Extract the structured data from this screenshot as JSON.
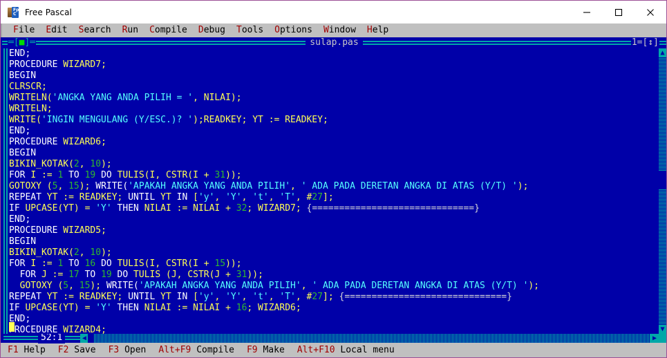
{
  "window": {
    "title": "Free Pascal",
    "icon": "free-pascal-logo-icon",
    "controls": {
      "minimize": "minimize-icon",
      "maximize": "maximize-icon",
      "close": "close-icon"
    }
  },
  "menubar": {
    "items": [
      {
        "hotkey": "F",
        "rest": "ile"
      },
      {
        "hotkey": "E",
        "rest": "dit"
      },
      {
        "hotkey": "S",
        "rest": "earch"
      },
      {
        "hotkey": "R",
        "rest": "un"
      },
      {
        "hotkey": "C",
        "rest": "ompile"
      },
      {
        "hotkey": "D",
        "rest": "ebug"
      },
      {
        "hotkey": "T",
        "rest": "ools"
      },
      {
        "hotkey": "O",
        "rest": "ptions"
      },
      {
        "hotkey": "W",
        "rest": "indow"
      },
      {
        "hotkey": "H",
        "rest": "elp"
      }
    ]
  },
  "editor": {
    "close_box": "[■]",
    "file_name": "sulap.pas",
    "window_number": "1=[↕]",
    "position": "52:1",
    "colors": {
      "background": "#0000a8",
      "keyword": "#ffffff",
      "identifier": "#ffff55",
      "string": "#55ffff",
      "number": "#2fb82f",
      "comment": "#d8d8d8",
      "frame": "#00a8a8"
    },
    "lines": [
      [
        {
          "t": "END;",
          "c": "kw"
        }
      ],
      [
        {
          "t": "PROCEDURE ",
          "c": "kw"
        },
        {
          "t": "WIZARD7;",
          "c": "id"
        }
      ],
      [
        {
          "t": "BEGIN",
          "c": "kw"
        }
      ],
      [
        {
          "t": "CLRSCR;",
          "c": "id"
        }
      ],
      [
        {
          "t": "WRITELN(",
          "c": "id"
        },
        {
          "t": "'ANGKA YANG ANDA PILIH = '",
          "c": "str"
        },
        {
          "t": ", NILAI);",
          "c": "id"
        }
      ],
      [
        {
          "t": "WRITELN;",
          "c": "id"
        }
      ],
      [
        {
          "t": "WRITE(",
          "c": "id"
        },
        {
          "t": "'INGIN MENGULANG (Y/ESC.)? '",
          "c": "str"
        },
        {
          "t": ");READKEY; YT := READKEY;",
          "c": "id"
        }
      ],
      [
        {
          "t": "END;",
          "c": "kw"
        }
      ],
      [
        {
          "t": "PROCEDURE ",
          "c": "kw"
        },
        {
          "t": "WIZARD6;",
          "c": "id"
        }
      ],
      [
        {
          "t": "BEGIN",
          "c": "kw"
        }
      ],
      [
        {
          "t": "BIKIN_KOTAK(",
          "c": "id"
        },
        {
          "t": "2",
          "c": "num"
        },
        {
          "t": ", ",
          "c": "id"
        },
        {
          "t": "10",
          "c": "num"
        },
        {
          "t": ");",
          "c": "id"
        }
      ],
      [
        {
          "t": "FOR ",
          "c": "kw"
        },
        {
          "t": "I := ",
          "c": "id"
        },
        {
          "t": "1",
          "c": "num"
        },
        {
          "t": " TO ",
          "c": "kw"
        },
        {
          "t": "19",
          "c": "num"
        },
        {
          "t": " DO ",
          "c": "kw"
        },
        {
          "t": "TULIS(I, CSTR(I + ",
          "c": "id"
        },
        {
          "t": "31",
          "c": "num"
        },
        {
          "t": "));",
          "c": "id"
        }
      ],
      [
        {
          "t": "GOTOXY (",
          "c": "id"
        },
        {
          "t": "5",
          "c": "num"
        },
        {
          "t": ", ",
          "c": "id"
        },
        {
          "t": "15",
          "c": "num"
        },
        {
          "t": "); ",
          "c": "id"
        },
        {
          "t": "WRITE(",
          "c": "kw"
        },
        {
          "t": "'APAKAH ANGKA YANG ANDA PILIH'",
          "c": "str"
        },
        {
          "t": ", ",
          "c": "id"
        },
        {
          "t": "' ADA PADA DERETAN ANGKA DI ATAS (Y/T) '",
          "c": "str"
        },
        {
          "t": ");",
          "c": "id"
        }
      ],
      [
        {
          "t": "REPEAT ",
          "c": "kw"
        },
        {
          "t": "YT := READKEY; ",
          "c": "id"
        },
        {
          "t": "UNTIL ",
          "c": "kw"
        },
        {
          "t": "YT ",
          "c": "id"
        },
        {
          "t": "IN ",
          "c": "kw"
        },
        {
          "t": "[",
          "c": "id"
        },
        {
          "t": "'y'",
          "c": "str"
        },
        {
          "t": ", ",
          "c": "id"
        },
        {
          "t": "'Y'",
          "c": "str"
        },
        {
          "t": ", ",
          "c": "id"
        },
        {
          "t": "'t'",
          "c": "str"
        },
        {
          "t": ", ",
          "c": "id"
        },
        {
          "t": "'T'",
          "c": "str"
        },
        {
          "t": ", #",
          "c": "id"
        },
        {
          "t": "27",
          "c": "num"
        },
        {
          "t": "];",
          "c": "id"
        }
      ],
      [
        {
          "t": "IF ",
          "c": "kw"
        },
        {
          "t": "UPCASE(YT) = ",
          "c": "id"
        },
        {
          "t": "'Y'",
          "c": "str"
        },
        {
          "t": " THEN ",
          "c": "kw"
        },
        {
          "t": "NILAI := NILAI + ",
          "c": "id"
        },
        {
          "t": "32",
          "c": "num"
        },
        {
          "t": "; WIZARD7; ",
          "c": "id"
        },
        {
          "t": "{==============================}",
          "c": "cmt"
        }
      ],
      [
        {
          "t": "END;",
          "c": "kw"
        }
      ],
      [
        {
          "t": "PROCEDURE ",
          "c": "kw"
        },
        {
          "t": "WIZARD5;",
          "c": "id"
        }
      ],
      [
        {
          "t": "BEGIN",
          "c": "kw"
        }
      ],
      [
        {
          "t": "BIKIN_KOTAK(",
          "c": "id"
        },
        {
          "t": "2",
          "c": "num"
        },
        {
          "t": ", ",
          "c": "id"
        },
        {
          "t": "10",
          "c": "num"
        },
        {
          "t": ");",
          "c": "id"
        }
      ],
      [
        {
          "t": "FOR ",
          "c": "kw"
        },
        {
          "t": "I := ",
          "c": "id"
        },
        {
          "t": "1",
          "c": "num"
        },
        {
          "t": " TO ",
          "c": "kw"
        },
        {
          "t": "16",
          "c": "num"
        },
        {
          "t": " DO ",
          "c": "kw"
        },
        {
          "t": "TULIS(I, CSTR(I + ",
          "c": "id"
        },
        {
          "t": "15",
          "c": "num"
        },
        {
          "t": "));",
          "c": "id"
        }
      ],
      [
        {
          "t": "  FOR ",
          "c": "kw"
        },
        {
          "t": "J := ",
          "c": "id"
        },
        {
          "t": "17",
          "c": "num"
        },
        {
          "t": " TO ",
          "c": "kw"
        },
        {
          "t": "19",
          "c": "num"
        },
        {
          "t": " DO ",
          "c": "kw"
        },
        {
          "t": "TULIS (J, CSTR(J + ",
          "c": "id"
        },
        {
          "t": "31",
          "c": "num"
        },
        {
          "t": "));",
          "c": "id"
        }
      ],
      [
        {
          "t": "  GOTOXY (",
          "c": "id"
        },
        {
          "t": "5",
          "c": "num"
        },
        {
          "t": ", ",
          "c": "id"
        },
        {
          "t": "15",
          "c": "num"
        },
        {
          "t": "); ",
          "c": "id"
        },
        {
          "t": "WRITE(",
          "c": "kw"
        },
        {
          "t": "'APAKAH ANGKA YANG ANDA PILIH'",
          "c": "str"
        },
        {
          "t": ", ",
          "c": "id"
        },
        {
          "t": "' ADA PADA DERETAN ANGKA DI ATAS (Y/T) '",
          "c": "str"
        },
        {
          "t": ");",
          "c": "id"
        }
      ],
      [
        {
          "t": "REPEAT ",
          "c": "kw"
        },
        {
          "t": "YT := READKEY; ",
          "c": "id"
        },
        {
          "t": "UNTIL ",
          "c": "kw"
        },
        {
          "t": "YT ",
          "c": "id"
        },
        {
          "t": "IN ",
          "c": "kw"
        },
        {
          "t": "[",
          "c": "id"
        },
        {
          "t": "'y'",
          "c": "str"
        },
        {
          "t": ", ",
          "c": "id"
        },
        {
          "t": "'Y'",
          "c": "str"
        },
        {
          "t": ", ",
          "c": "id"
        },
        {
          "t": "'t'",
          "c": "str"
        },
        {
          "t": ", ",
          "c": "id"
        },
        {
          "t": "'T'",
          "c": "str"
        },
        {
          "t": ", #",
          "c": "id"
        },
        {
          "t": "27",
          "c": "num"
        },
        {
          "t": "]; ",
          "c": "id"
        },
        {
          "t": "{==============================}",
          "c": "cmt"
        }
      ],
      [
        {
          "t": "IF ",
          "c": "kw"
        },
        {
          "t": "UPCASE(YT) = ",
          "c": "id"
        },
        {
          "t": "'Y'",
          "c": "str"
        },
        {
          "t": " THEN ",
          "c": "kw"
        },
        {
          "t": "NILAI := NILAI + ",
          "c": "id"
        },
        {
          "t": "16",
          "c": "num"
        },
        {
          "t": "; WIZARD6;",
          "c": "id"
        }
      ],
      [
        {
          "t": "END;",
          "c": "kw"
        }
      ],
      [
        {
          "t": "PROCEDURE ",
          "c": "kw"
        },
        {
          "t": "WIZARD4;",
          "c": "id"
        }
      ]
    ]
  },
  "statusbar": {
    "items": [
      {
        "key": "F1",
        "label": "Help"
      },
      {
        "key": "F2",
        "label": "Save"
      },
      {
        "key": "F3",
        "label": "Open"
      },
      {
        "key": "Alt+F9",
        "label": "Compile"
      },
      {
        "key": "F9",
        "label": "Make"
      },
      {
        "key": "Alt+F10",
        "label": "Local menu"
      }
    ]
  }
}
